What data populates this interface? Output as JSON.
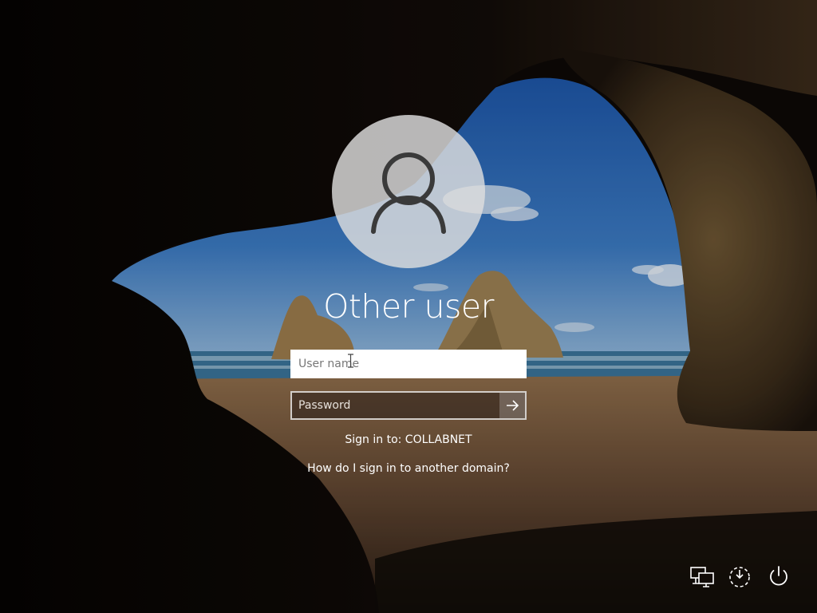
{
  "login": {
    "title": "Other user",
    "username_placeholder": "User name",
    "password_placeholder": "Password",
    "sign_in_to": "Sign in to: COLLABNET",
    "another_domain_link": "How do I sign in to another domain?"
  },
  "tray": {
    "icons": [
      "network-icon",
      "ease-of-access-icon",
      "power-icon"
    ]
  },
  "colors": {
    "sky": "#2a6bb8",
    "sea": "#3f7ea3",
    "sand": "#8a6a48",
    "cave": "#1a120c",
    "avatar_bg": "#dedede",
    "avatar_glyph": "#3a3a3a"
  }
}
